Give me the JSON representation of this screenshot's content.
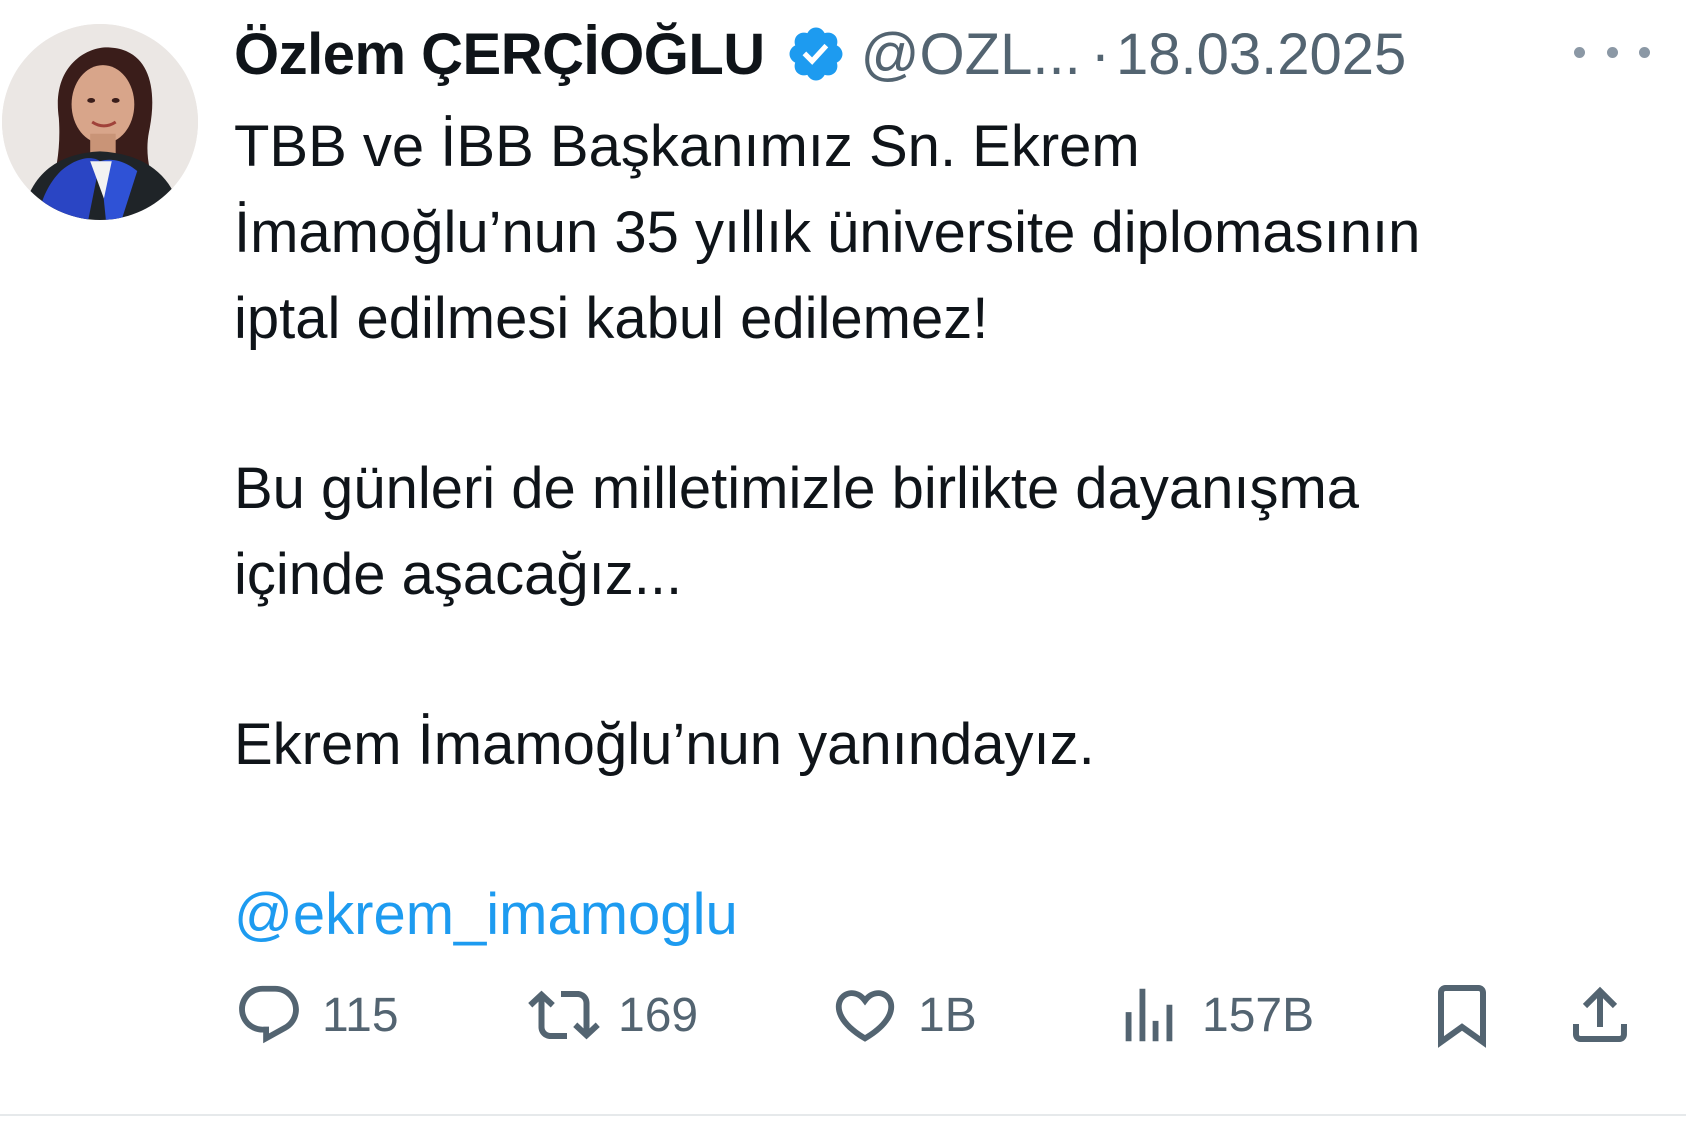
{
  "author": {
    "name": "Özlem ÇERÇİOĞLU",
    "handle": "@OZL...",
    "separator": "·",
    "date": "18.03.2025",
    "avatar_icon": "profile-photo",
    "verified_icon": "verified-badge-icon"
  },
  "tweet": {
    "lines": [
      "TBB ve İBB Başkanımız Sn. Ekrem",
      "İmamoğlu’nun 35 yıllık üniversite diplomasının",
      "iptal edilmesi kabul edilemez!",
      "Bu günleri de milletimizle birlikte dayanışma",
      "içinde aşacağız...",
      "Ekrem İmamoğlu’nun yanındayız.",
      "@ekrem_imamoglu"
    ]
  },
  "actions": {
    "replies": "115",
    "reposts": "169",
    "likes": "1B",
    "views": "157B"
  },
  "colors": {
    "accent": "#1d9bf0",
    "text": "#0f1419",
    "secondary": "#536471",
    "icon": "#536471"
  }
}
